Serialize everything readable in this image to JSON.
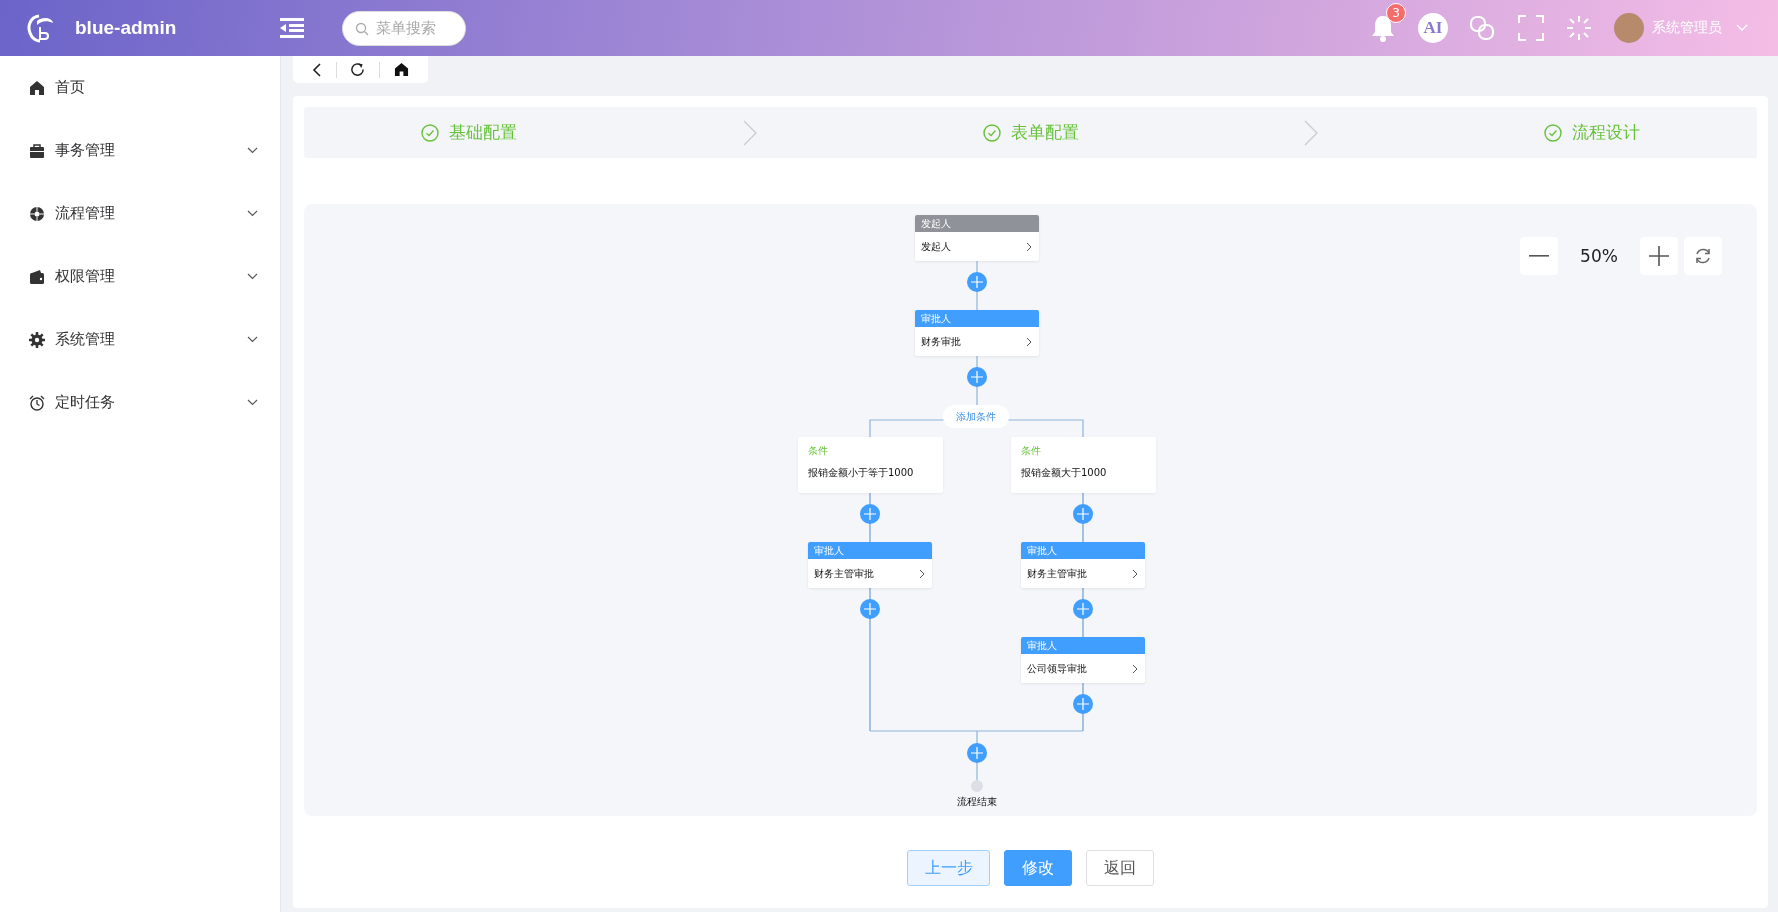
{
  "header": {
    "logo_text": "blue-admin",
    "search": {
      "placeholder": "菜单搜索"
    },
    "notification_count": "3",
    "ai_label": "AI",
    "user_name": "系统管理员"
  },
  "sidebar": {
    "items": [
      {
        "label": "首页",
        "has_children": false
      },
      {
        "label": "事务管理",
        "has_children": true
      },
      {
        "label": "流程管理",
        "has_children": true
      },
      {
        "label": "权限管理",
        "has_children": true
      },
      {
        "label": "系统管理",
        "has_children": true
      },
      {
        "label": "定时任务",
        "has_children": true
      }
    ]
  },
  "steps": [
    {
      "label": "基础配置",
      "completed": true
    },
    {
      "label": "表单配置",
      "completed": true
    },
    {
      "label": "流程设计",
      "completed": true
    }
  ],
  "zoom": {
    "value": "50%"
  },
  "flow": {
    "nodes": [
      {
        "kind": "initiator",
        "header": "发起人",
        "label": "发起人"
      },
      {
        "kind": "approver",
        "header": "审批人",
        "label": "财务审批"
      }
    ],
    "add_condition": "添加条件",
    "branches": [
      {
        "title": "条件",
        "condition": "报销金额小于等于1000",
        "nodes": [
          {
            "kind": "approver",
            "header": "审批人",
            "label": "财务主管审批"
          }
        ]
      },
      {
        "title": "条件",
        "condition": "报销金额大于1000",
        "nodes": [
          {
            "kind": "approver",
            "header": "审批人",
            "label": "财务主管审批"
          },
          {
            "kind": "approver",
            "header": "审批人",
            "label": "公司领导审批"
          }
        ]
      }
    ],
    "end": "流程结束"
  },
  "buttons": [
    {
      "label": "上一步",
      "kind": "plain"
    },
    {
      "label": "修改",
      "kind": "primary"
    },
    {
      "label": "返回",
      "kind": "default"
    }
  ]
}
